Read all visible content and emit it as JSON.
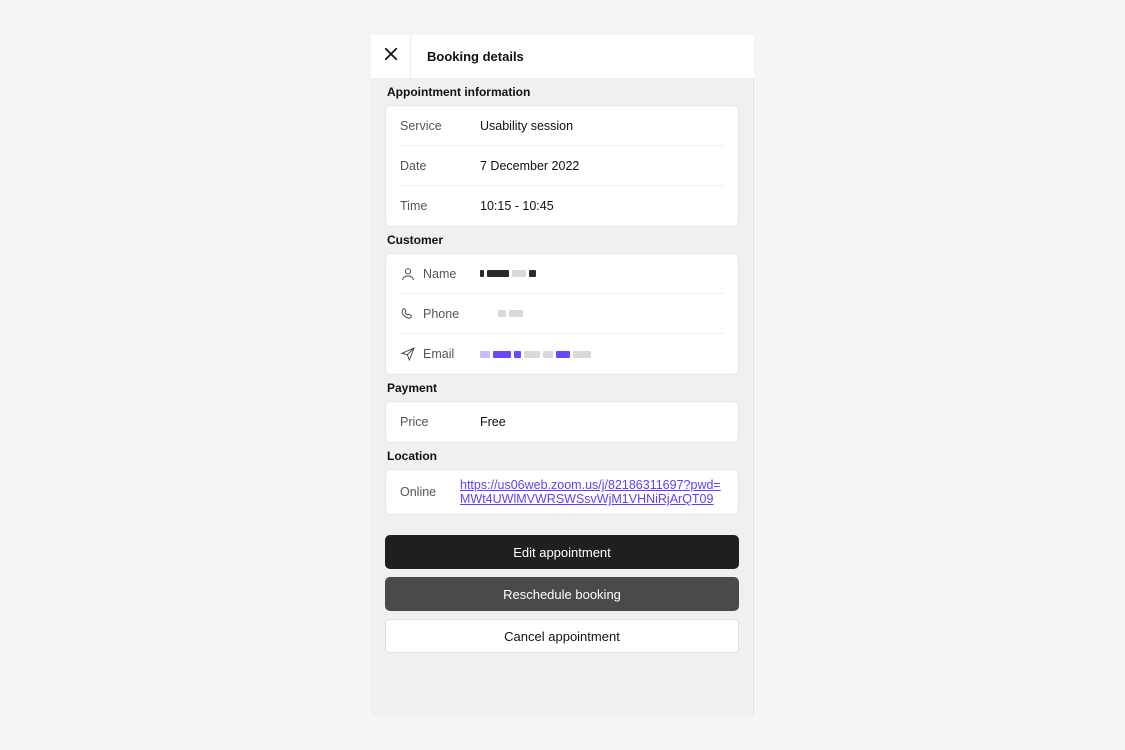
{
  "header": {
    "title": "Booking details"
  },
  "sections": {
    "appointment": {
      "label": "Appointment information",
      "service_label": "Service",
      "service_value": "Usability session",
      "date_label": "Date",
      "date_value": "7 December 2022",
      "time_label": "Time",
      "time_value": "10:15 - 10:45"
    },
    "customer": {
      "label": "Customer",
      "name_label": "Name",
      "phone_label": "Phone",
      "email_label": "Email"
    },
    "payment": {
      "label": "Payment",
      "price_label": "Price",
      "price_value": "Free"
    },
    "location": {
      "label": "Location",
      "online_label": "Online",
      "url_text": "https://us06web.zoom.us/j/82186311697?pwd=MWt4UWlMVWRSWSsvWjM1VHNiRjArQT09"
    }
  },
  "actions": {
    "edit": "Edit appointment",
    "reschedule": "Reschedule booking",
    "cancel": "Cancel appointment"
  }
}
